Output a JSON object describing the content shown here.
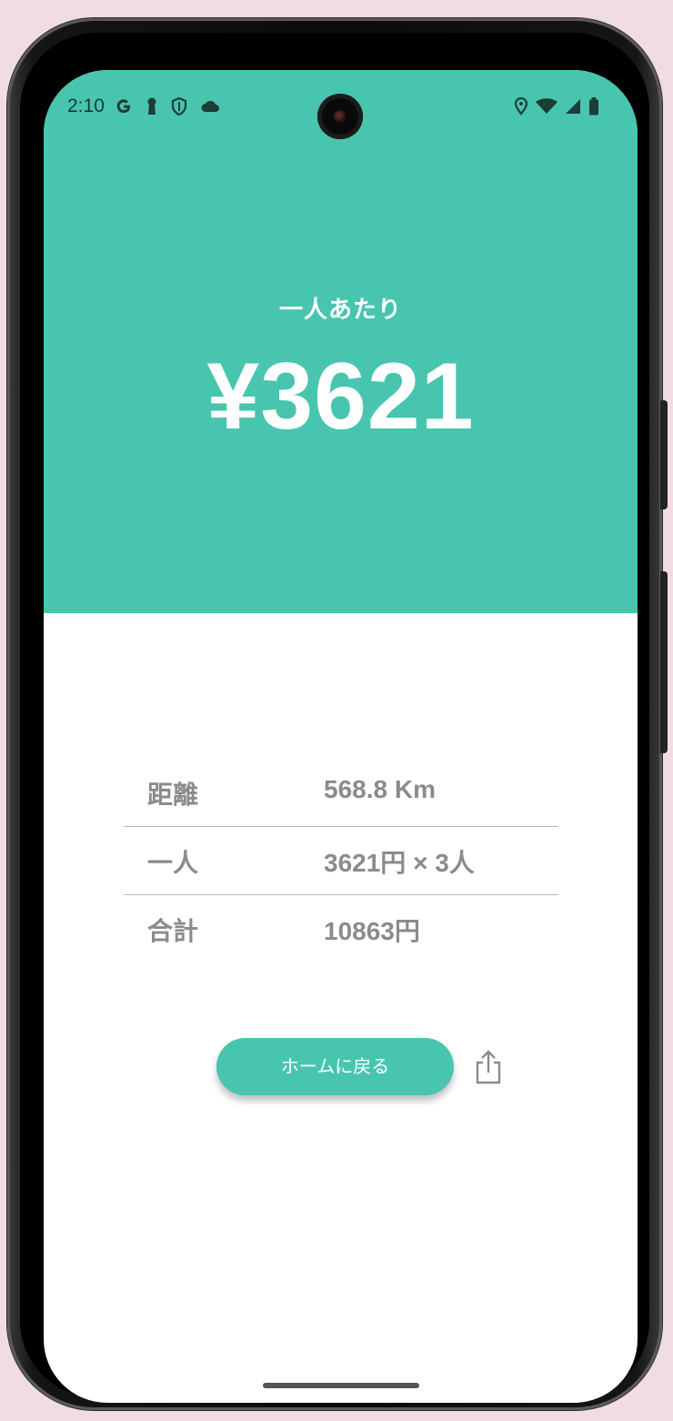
{
  "status_bar": {
    "time": "2:10",
    "left_icons": [
      "google-icon",
      "keyhole-icon",
      "shield-icon",
      "cloud-icon"
    ],
    "right_icons": [
      "location-icon",
      "wifi-icon",
      "signal-icon",
      "battery-icon"
    ]
  },
  "hero": {
    "label": "一人あたり",
    "amount": "¥3621",
    "color": "#48c5af"
  },
  "breakdown": [
    {
      "key": "距離",
      "value": "568.8 Km"
    },
    {
      "key": "一人",
      "value": "3621円 × 3人"
    },
    {
      "key": "合計",
      "value": "10863円"
    }
  ],
  "actions": {
    "home_label": "ホームに戻る",
    "share_icon": "share-icon"
  }
}
